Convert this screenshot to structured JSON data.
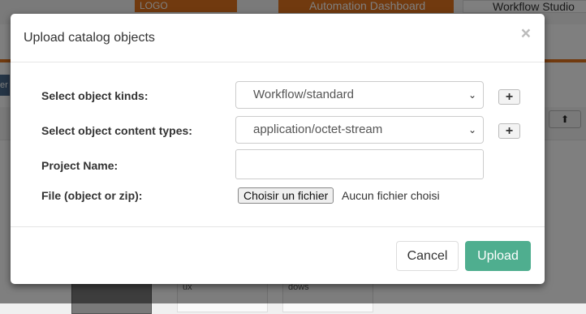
{
  "background": {
    "logo_text": "LOGO",
    "automation_label": "Automation Dashboard",
    "studio_label": "Workflow Studio",
    "left_tab_label": "er",
    "card2_text": "ux",
    "card3_text": "dows"
  },
  "modal": {
    "title": "Upload catalog objects",
    "close_symbol": "×",
    "fields": {
      "object_kinds_label": "Select object kinds:",
      "object_kinds_value": "Workflow/standard",
      "content_types_label": "Select object content types:",
      "content_types_value": "application/octet-stream",
      "project_name_label": "Project Name:",
      "project_name_value": "",
      "file_label": "File (object or zip):",
      "file_button_label": "Choisir un fichier",
      "file_status": "Aucun fichier choisi"
    },
    "plus_symbol": "+",
    "footer": {
      "cancel_label": "Cancel",
      "upload_label": "Upload"
    }
  },
  "colors": {
    "accent_orange": "#e2741f",
    "upload_green": "#4fae8f"
  }
}
